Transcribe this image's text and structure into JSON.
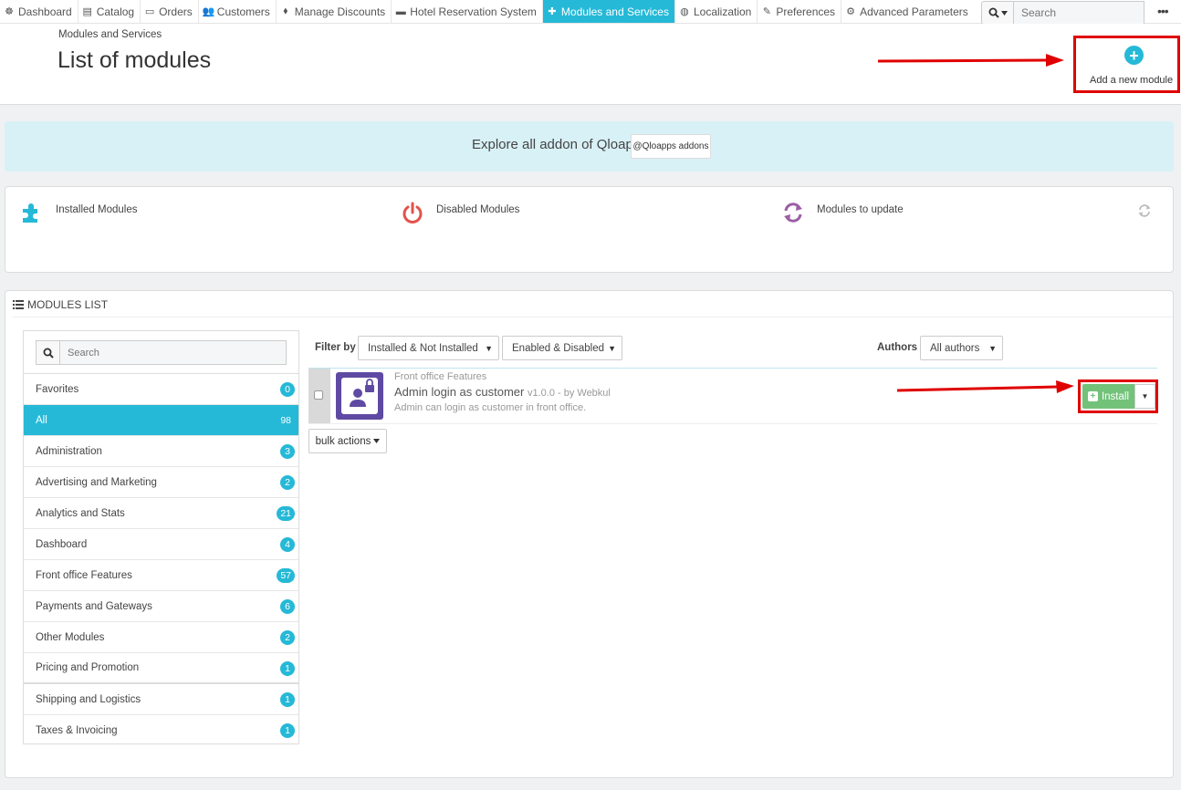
{
  "nav": {
    "tabs": [
      {
        "label": "Dashboard",
        "icon": "dashboard-icon",
        "glyph": "☸"
      },
      {
        "label": "Catalog",
        "icon": "book-icon",
        "glyph": "▤"
      },
      {
        "label": "Orders",
        "icon": "credit-card-icon",
        "glyph": "▭"
      },
      {
        "label": "Customers",
        "icon": "users-icon",
        "glyph": "👥"
      },
      {
        "label": "Manage Discounts",
        "icon": "tags-icon",
        "glyph": "⬧"
      },
      {
        "label": "Hotel Reservation System",
        "icon": "bed-icon",
        "glyph": "▬"
      },
      {
        "label": "Modules and Services",
        "icon": "puzzle-icon",
        "glyph": "✚"
      },
      {
        "label": "Localization",
        "icon": "globe-icon",
        "glyph": "◍"
      },
      {
        "label": "Preferences",
        "icon": "wrench-icon",
        "glyph": "✎"
      },
      {
        "label": "Advanced Parameters",
        "icon": "cogs-icon",
        "glyph": "⚙"
      }
    ],
    "search_placeholder": "Search",
    "more_label": "•••"
  },
  "header": {
    "breadcrumb": "Modules and Services",
    "title": "List of modules",
    "add_module_label": "Add a new module"
  },
  "addons": {
    "text": "Explore all addon of Qloapps",
    "button_label": "@Qloapps addons"
  },
  "stats": {
    "installed": "Installed Modules",
    "disabled": "Disabled Modules",
    "to_update": "Modules to update"
  },
  "modules_list": {
    "heading": "MODULES LIST",
    "search_placeholder": "Search",
    "categories": [
      {
        "label": "Favorites",
        "count": "0"
      },
      {
        "label": "All",
        "count": "98"
      },
      {
        "label": "Administration",
        "count": "3"
      },
      {
        "label": "Advertising and Marketing",
        "count": "2"
      },
      {
        "label": "Analytics and Stats",
        "count": "21"
      },
      {
        "label": "Dashboard",
        "count": "4"
      },
      {
        "label": "Front office Features",
        "count": "57"
      },
      {
        "label": "Payments and Gateways",
        "count": "6"
      },
      {
        "label": "Other Modules",
        "count": "2"
      },
      {
        "label": "Pricing and Promotion",
        "count": "1"
      },
      {
        "label": "Shipping and Logistics",
        "count": "1"
      },
      {
        "label": "Taxes & Invoicing",
        "count": "1"
      }
    ],
    "filter_label": "Filter by",
    "filter_install": "Installed & Not Installed",
    "filter_enabled": "Enabled & Disabled",
    "authors_label": "Authors",
    "authors_value": "All authors",
    "module": {
      "category": "Front office Features",
      "name": "Admin login as customer",
      "version": "v1.0.0 - by Webkul",
      "description": "Admin can login as customer in front office.",
      "install_label": "Install"
    },
    "bulk_label": "bulk actions"
  },
  "colors": {
    "accent": "#25b9d7",
    "install_green": "#72c279",
    "annotation_red": "#e00000"
  }
}
